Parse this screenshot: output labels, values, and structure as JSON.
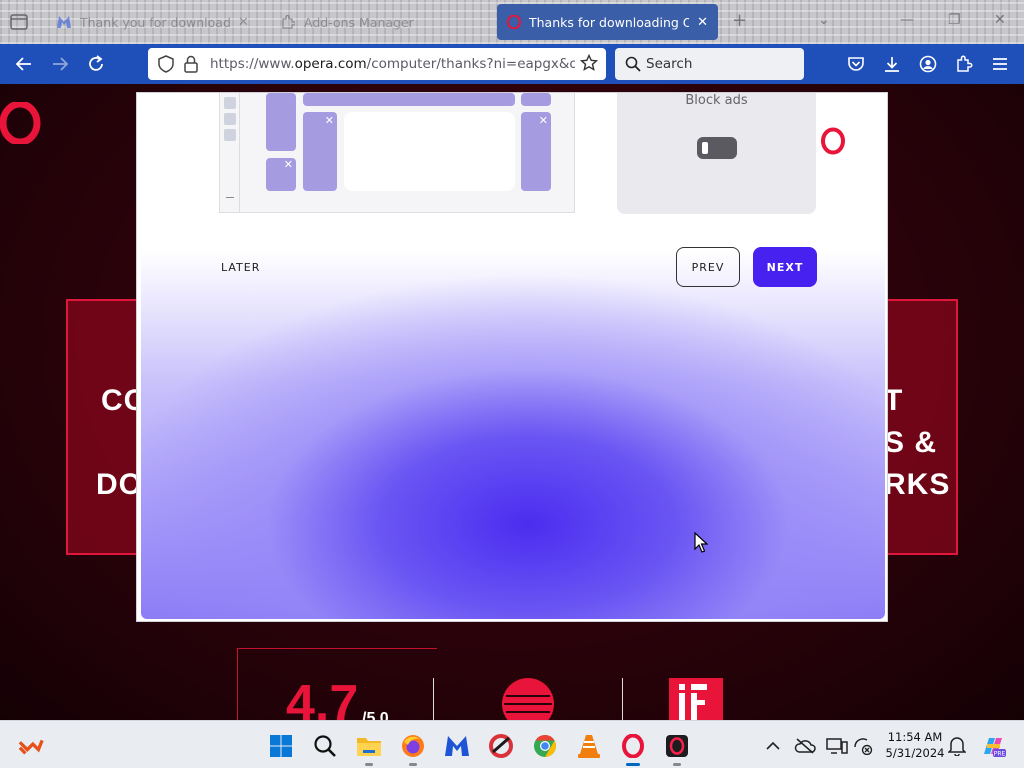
{
  "browser": {
    "tabs": [
      {
        "title": "Thank you for downloading",
        "favicon": "malwarebytes-icon",
        "active": false
      },
      {
        "title": "Add-ons Manager",
        "favicon": "puzzle-icon",
        "active": false
      },
      {
        "title": "Thanks for downloading Opera",
        "favicon": "opera-icon",
        "active": true
      }
    ],
    "new_tab_label": "+",
    "url": {
      "prefix": "https://www.",
      "domain": "opera.com",
      "path": "/computer/thanks?ni=eapgx&os=wi"
    },
    "search_placeholder": "Search"
  },
  "page": {
    "hero_left_1": "CO",
    "hero_left_2": "DO",
    "hero_right_1": "T",
    "hero_right_2": "S &",
    "hero_right_3": "RKS",
    "rating_value": "4.7",
    "rating_suffix": "/5.0"
  },
  "modal": {
    "adblock_label": "Block ads",
    "adblock_enabled": false,
    "later_label": "LATER",
    "prev_label": "PREV",
    "next_label": "NEXT"
  },
  "taskbar": {
    "apps": [
      "windows-start-icon",
      "search-icon",
      "file-explorer-icon",
      "firefox-icon",
      "malwarebytes-icon",
      "ccleaner-icon",
      "chrome-icon",
      "vlc-icon",
      "opera-icon",
      "opera-gx-icon"
    ],
    "time": "11:54 AM",
    "date": "5/31/2024"
  },
  "colors": {
    "nav_blue": "#1f4fb8",
    "active_tab": "#3b5ea8",
    "next_button": "#4721ef",
    "opera_red": "#e8143a"
  }
}
